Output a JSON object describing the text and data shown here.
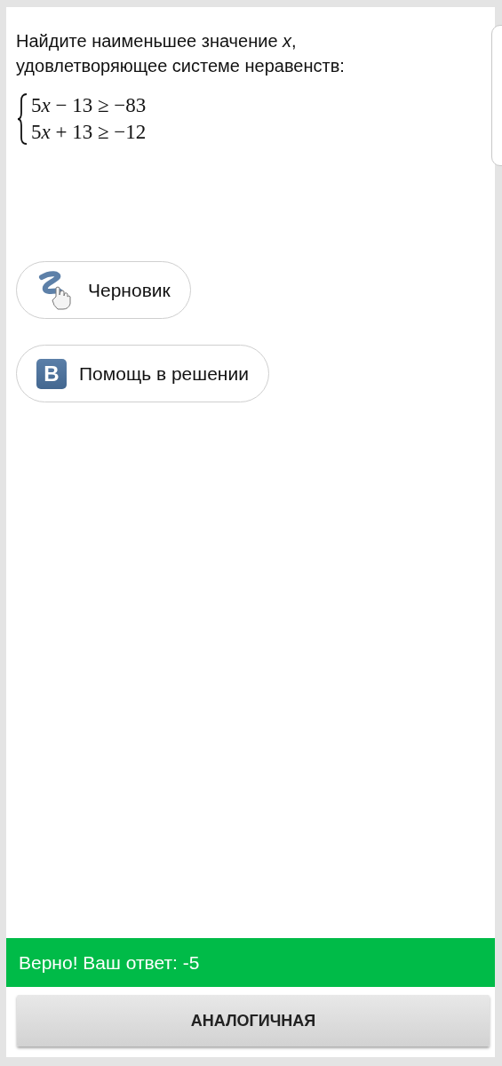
{
  "question": {
    "text": "Найдите наименьшее значение *x*,\nудовлетворяющее системе неравенств:",
    "system": [
      {
        "coef": "5",
        "var": "x",
        "rest": " − 13 ≥ −83"
      },
      {
        "coef": "5",
        "var": "x",
        "rest": " + 13 ≥ −12"
      }
    ]
  },
  "tools": [
    {
      "kind": "draft",
      "label": "Черновик"
    },
    {
      "kind": "help",
      "icon_letter": "В",
      "label": "Помощь в решении"
    }
  ],
  "result": {
    "correct": true,
    "text": "Верно! Ваш ответ: -5"
  },
  "next_button": "АНАЛОГИЧНАЯ"
}
